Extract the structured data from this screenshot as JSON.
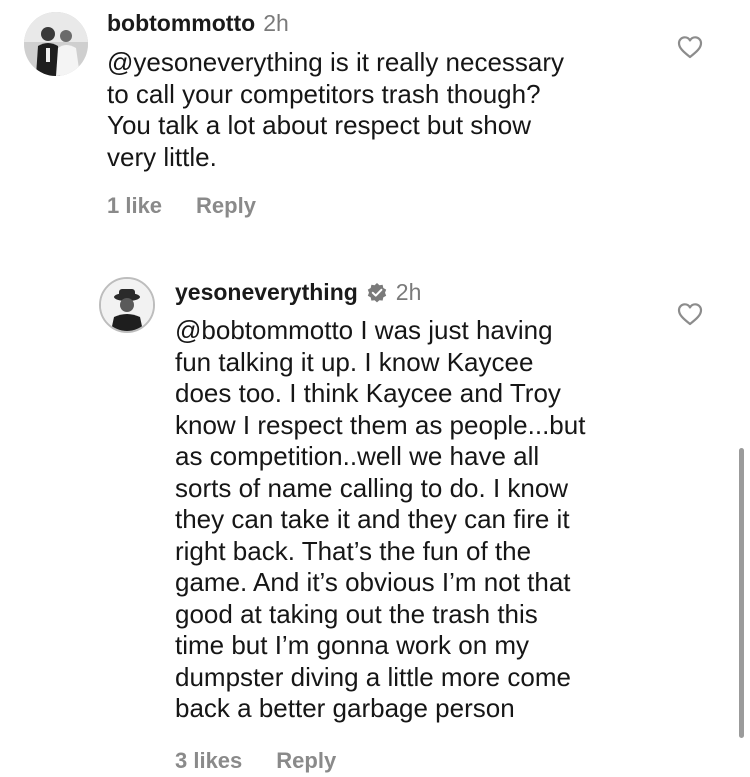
{
  "comments": [
    {
      "username": "bobtommotto",
      "time": "2h",
      "mention": "@yesoneverything",
      "lines": [
        " is it really necessary",
        "to call your competitors trash though?",
        "You talk a lot about respect but show",
        "very little."
      ],
      "likes": "1 like",
      "reply": "Reply",
      "verified": false,
      "like_icon": "heart-outline-icon"
    },
    {
      "username": "yesoneverything",
      "time": "2h",
      "mention": "@bobtommotto",
      "lines": [
        " I was just having",
        "fun talking it up. I know Kaycee",
        "does too. I think Kaycee and Troy",
        "know I respect them as people...but",
        "as competition..well we have all",
        "sorts of name calling to do. I know",
        "they can take it and they can fire it",
        "right back. That’s the fun of the",
        "game. And it’s obvious I’m not that",
        "good at taking out the trash this",
        "time but I’m gonna work on my",
        "dumpster diving a little more come",
        "back a better garbage person"
      ],
      "likes": "3 likes",
      "reply": "Reply",
      "verified": true,
      "verified_icon": "verified-badge-icon",
      "like_icon": "heart-outline-icon"
    }
  ]
}
